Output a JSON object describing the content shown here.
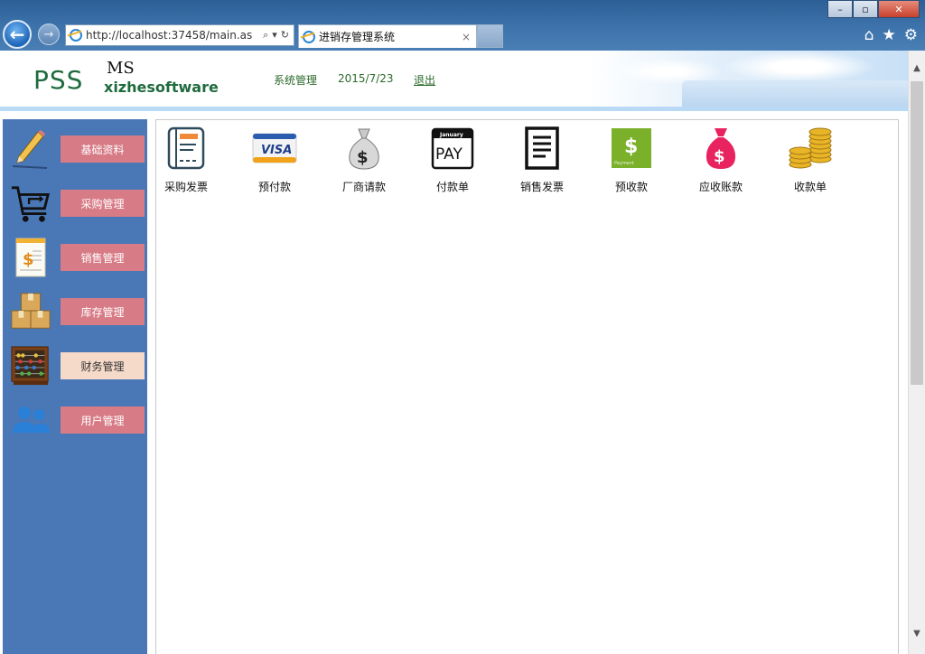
{
  "browser": {
    "address": "http://localhost:37458/main.as",
    "tab_title": "进销存管理系统",
    "tab_close": "×",
    "win_min": "–",
    "win_max": "▫",
    "win_close": "✕",
    "back_glyph": "←",
    "forward_glyph": "→"
  },
  "header": {
    "logo": "PSS",
    "logo_ms": "MS",
    "logo_sub": "xizhesoftware",
    "nav_system": "系统管理",
    "date": "2015/7/23",
    "logout": "退出"
  },
  "sidebar": {
    "items": [
      {
        "label": "基础资料",
        "icon": "pencil-icon"
      },
      {
        "label": "采购管理",
        "icon": "cart-icon"
      },
      {
        "label": "销售管理",
        "icon": "invoice-icon"
      },
      {
        "label": "库存管理",
        "icon": "boxes-icon"
      },
      {
        "label": "财务管理",
        "icon": "abacus-icon",
        "active": true
      },
      {
        "label": "用户管理",
        "icon": "users-icon"
      }
    ]
  },
  "finance": {
    "items": [
      {
        "label": "采购发票",
        "icon": "purchase-invoice-icon"
      },
      {
        "label": "预付款",
        "icon": "visa-card-icon"
      },
      {
        "label": "厂商请款",
        "icon": "money-bag-icon"
      },
      {
        "label": "付款单",
        "icon": "pay-calendar-icon"
      },
      {
        "label": "销售发票",
        "icon": "sales-invoice-icon"
      },
      {
        "label": "预收款",
        "icon": "payment-icon"
      },
      {
        "label": "应收账款",
        "icon": "receivable-bag-icon"
      },
      {
        "label": "收款单",
        "icon": "coins-icon"
      }
    ]
  },
  "icons_text": {
    "visa": "VISA",
    "pay_month": "January",
    "pay": "PAY",
    "payment": "Payment",
    "dollar": "$"
  },
  "colors": {
    "sidebar_bg": "#4a78b7",
    "menu_item": "#d77b86",
    "menu_active": "#f5d9c9",
    "brand_green": "#1f6b3f"
  }
}
